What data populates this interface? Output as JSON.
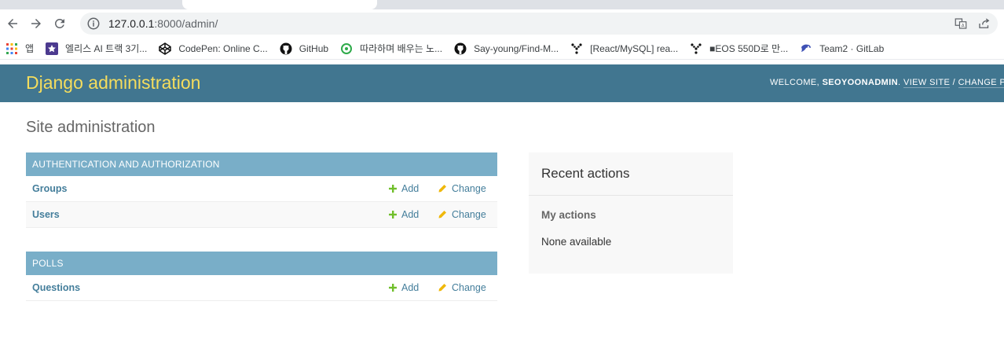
{
  "browser": {
    "url_host": "127.0.0.1",
    "url_path": ":8000/admin/",
    "bookmarks": [
      {
        "label": "앱",
        "icon": "apps-grid-icon"
      },
      {
        "label": "엘리스 AI 트랙 3기...",
        "icon": "elice-icon"
      },
      {
        "label": "CodePen: Online C...",
        "icon": "codepen-icon"
      },
      {
        "label": "GitHub",
        "icon": "github-icon"
      },
      {
        "label": "따라하며 배우는 노...",
        "icon": "green-circle-icon"
      },
      {
        "label": "Say-young/Find-M...",
        "icon": "github-icon"
      },
      {
        "label": "[React/MySQL] rea...",
        "icon": "velog-icon"
      },
      {
        "label": "■EOS 550D로 만...",
        "icon": "velog-icon"
      },
      {
        "label": "Team2 · GitLab",
        "icon": "gitlab-icon"
      }
    ]
  },
  "header": {
    "branding": "Django administration",
    "welcome": "WELCOME, ",
    "username": "SEOYOONADMIN",
    "dot": ". ",
    "view_site": "VIEW SITE",
    "slash": " / ",
    "change_password": "CHANGE PASSWORD"
  },
  "content": {
    "title": "Site administration",
    "modules": [
      {
        "caption": "AUTHENTICATION AND AUTHORIZATION",
        "rows": [
          {
            "model": "Groups",
            "add": "Add",
            "change": "Change"
          },
          {
            "model": "Users",
            "add": "Add",
            "change": "Change"
          }
        ]
      },
      {
        "caption": "POLLS",
        "rows": [
          {
            "model": "Questions",
            "add": "Add",
            "change": "Change"
          }
        ]
      }
    ]
  },
  "recent_actions": {
    "title": "Recent actions",
    "my_actions": "My actions",
    "none": "None available"
  },
  "colors": {
    "header_bg": "#417690",
    "branding": "#f5dd5d",
    "caption_bg": "#79aec8",
    "link": "#447e9b",
    "add_icon": "#70bf2b",
    "change_icon": "#efb80b"
  }
}
